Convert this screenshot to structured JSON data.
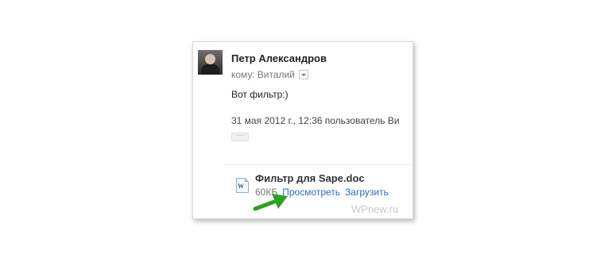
{
  "message": {
    "sender_name": "Петр Александров",
    "to_label": "кому:",
    "to_name": "Виталий",
    "body": "Вот фильтр:)",
    "quote_line": "31 мая 2012 г., 12:36 пользователь Ви",
    "ellipsis": "···"
  },
  "attachment": {
    "icon": "word-doc-icon",
    "filename": "Фильтр для Sape.doc",
    "size": "60КБ",
    "view_label": "Просмотреть",
    "download_label": "Загрузить"
  },
  "watermark": "WPnew.ru",
  "colors": {
    "link": "#2a6cc4",
    "arrow": "#2ea21f"
  }
}
